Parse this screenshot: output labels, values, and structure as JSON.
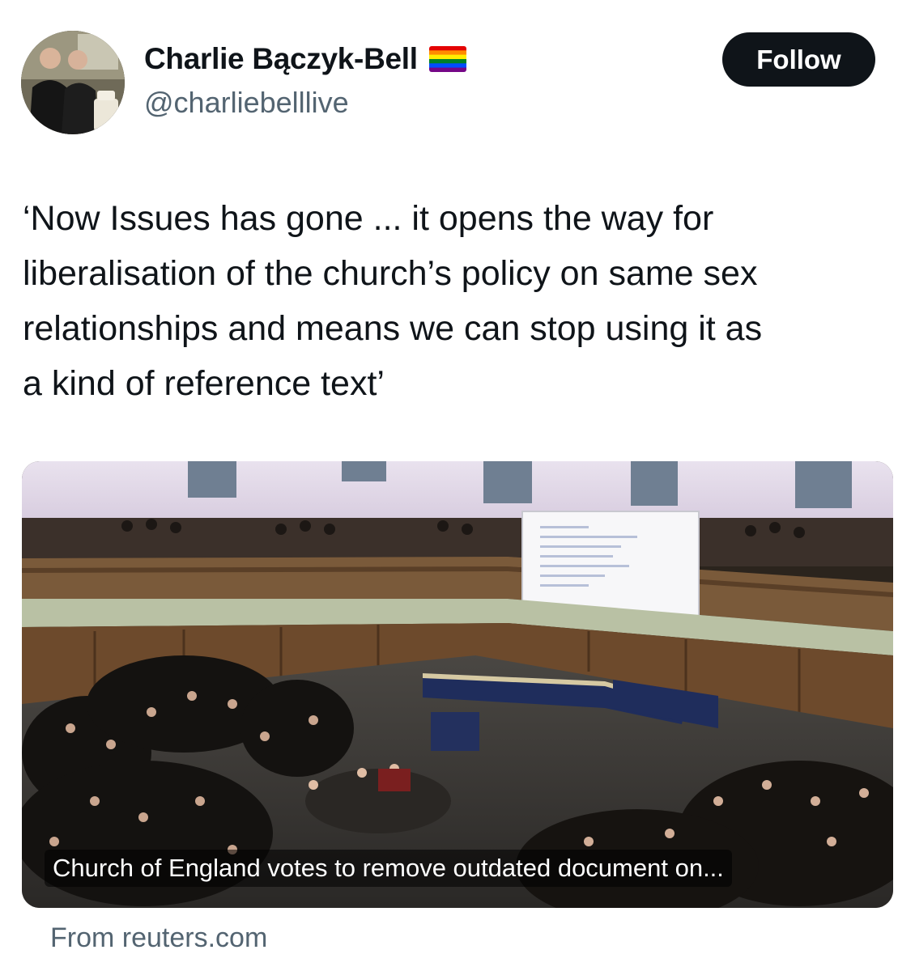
{
  "author": {
    "display_name": "Charlie Bączyk-Bell",
    "handle": "@charliebelllive",
    "badge_icon": "rainbow-flag-icon"
  },
  "follow_button": {
    "label": "Follow"
  },
  "tweet": {
    "text": "‘Now Issues has gone ... it opens the way for\nliberalisation of the church’s policy on same sex\nrelationships and means we can stop using it as\na kind of reference text’"
  },
  "link_card": {
    "title": "Church of England votes to remove outdated document on...",
    "source": "From reuters.com"
  },
  "colors": {
    "button_bg": "#0f1419",
    "secondary_text": "#536471"
  }
}
